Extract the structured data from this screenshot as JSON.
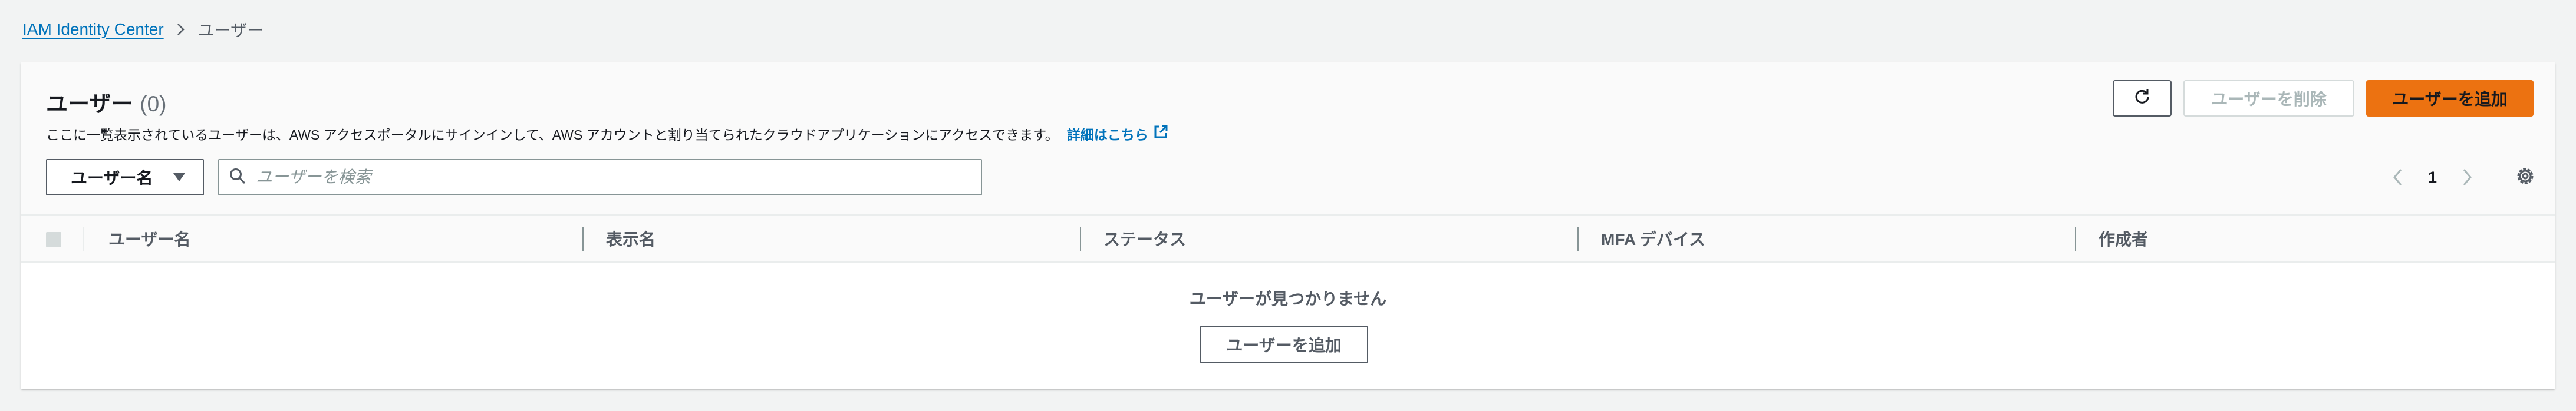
{
  "breadcrumb": {
    "parent": "IAM Identity Center",
    "current": "ユーザー"
  },
  "panel": {
    "title": "ユーザー",
    "count": "(0)",
    "description": "ここに一覧表示されているユーザーは、AWS アクセスポータルにサインインして、AWS アカウントと割り当てられたクラウドアプリケーションにアクセスできます。",
    "learn_more": "詳細はこちら"
  },
  "actions": {
    "refresh_icon": "refresh-icon",
    "delete_label": "ユーザーを削除",
    "add_label": "ユーザーを追加"
  },
  "filter": {
    "select_label": "ユーザー名",
    "search_placeholder": "ユーザーを検索"
  },
  "pagination": {
    "current_page": "1"
  },
  "table": {
    "columns": [
      "ユーザー名",
      "表示名",
      "ステータス",
      "MFA デバイス",
      "作成者"
    ],
    "rows": []
  },
  "empty_state": {
    "message": "ユーザーが見つかりません",
    "button_label": "ユーザーを追加"
  },
  "colors": {
    "primary": "#ec7211",
    "link": "#0073bb",
    "background": "#f2f3f3"
  }
}
